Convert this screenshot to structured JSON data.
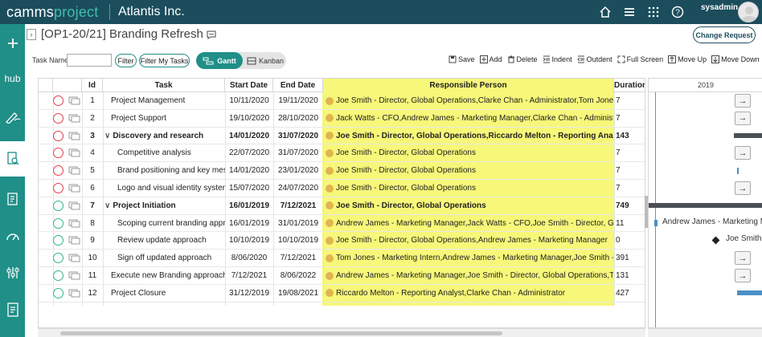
{
  "topbar": {
    "logo_a": "camms",
    "logo_b": "project",
    "org": "Atlantis Inc.",
    "user": "sysadmin",
    "icons": [
      "home-icon",
      "menu-icon",
      "apps-grid-icon",
      "help-icon"
    ]
  },
  "leftnav": {
    "items": [
      "add-icon",
      "hub",
      "pen-icon",
      "document-search-icon",
      "checklist-icon",
      "gauge-icon",
      "sliders-icon",
      "report-icon"
    ],
    "hub_label": "hub"
  },
  "title": {
    "project": "[OP1-20/21] Branding Refresh",
    "change_request": "Change Request"
  },
  "toolbar": {
    "task_name_label": "Task Name",
    "task_name_value": "",
    "filter": "Filter",
    "filter_my_tasks": "Filter My Tasks",
    "gantt": "Gantt",
    "kanban": "Kanban",
    "actions": [
      "Save",
      "Add",
      "Delete",
      "Indent",
      "Outdent",
      "Full Screen",
      "Move Up",
      "Move Down"
    ]
  },
  "grid": {
    "headers": {
      "id": "Id",
      "task": "Task",
      "start": "Start Date",
      "end": "End Date",
      "resp": "Responsible Person",
      "dur": "Duration"
    },
    "rows": [
      {
        "id": "1",
        "task": "Project Management",
        "start": "10/11/2020",
        "end": "19/11/2020",
        "resp": "Joe Smith - Director, Global Operations,Clarke Chan - Administrator,Tom Jones - Marketing Intern",
        "dur": "7",
        "status": "red",
        "bold": false,
        "indent": 0
      },
      {
        "id": "2",
        "task": "Project Support",
        "start": "19/10/2020",
        "end": "28/10/2020",
        "resp": "Jack Watts - CFO,Andrew James - Marketing Manager,Clarke Chan - Administrator",
        "dur": "7",
        "status": "red",
        "bold": false,
        "indent": 0
      },
      {
        "id": "3",
        "task": "Discovery and research",
        "start": "14/01/2020",
        "end": "31/07/2020",
        "resp": "Joe Smith - Director, Global Operations,Riccardo Melton - Reporting Analyst",
        "dur": "143",
        "status": "red",
        "bold": true,
        "indent": 0,
        "caret": "∨"
      },
      {
        "id": "4",
        "task": "Competitive analysis",
        "start": "22/07/2020",
        "end": "31/07/2020",
        "resp": "Joe Smith - Director, Global Operations",
        "dur": "7",
        "status": "red",
        "bold": false,
        "indent": 1
      },
      {
        "id": "5",
        "task": "Brand positioning and key messages",
        "start": "14/01/2020",
        "end": "23/01/2020",
        "resp": "Joe Smith - Director, Global Operations",
        "dur": "7",
        "status": "red",
        "bold": false,
        "indent": 1
      },
      {
        "id": "6",
        "task": "Logo and visual identity system update",
        "start": "15/07/2020",
        "end": "24/07/2020",
        "resp": "Joe Smith - Director, Global Operations",
        "dur": "7",
        "status": "red",
        "bold": false,
        "indent": 1
      },
      {
        "id": "7",
        "task": "Project Initiation",
        "start": "16/01/2019",
        "end": "7/12/2021",
        "resp": "Joe Smith - Director, Global Operations",
        "dur": "749",
        "status": "green",
        "bold": true,
        "indent": 0,
        "caret": "∨"
      },
      {
        "id": "8",
        "task": "Scoping current branding approach",
        "start": "16/01/2019",
        "end": "31/01/2019",
        "resp": "Andrew James - Marketing Manager,Jack Watts - CFO,Joe Smith - Director, Global Operations",
        "dur": "11",
        "status": "green",
        "bold": false,
        "indent": 1
      },
      {
        "id": "9",
        "task": "Review update approach",
        "start": "10/10/2019",
        "end": "10/10/2019",
        "resp": "Joe Smith - Director, Global Operations,Andrew James - Marketing Manager",
        "dur": "0",
        "status": "green",
        "bold": false,
        "indent": 1
      },
      {
        "id": "10",
        "task": "Sign off updated approach",
        "start": "8/06/2020",
        "end": "7/12/2021",
        "resp": "Tom Jones - Marketing Intern,Andrew James - Marketing Manager,Joe Smith - Director, Global Operations",
        "dur": "391",
        "status": "green",
        "bold": false,
        "indent": 1
      },
      {
        "id": "11",
        "task": "Execute new Branding approach",
        "start": "7/12/2021",
        "end": "8/06/2022",
        "resp": "Andrew James - Marketing Manager,Joe Smith - Director, Global Operations,Tom Jones - Marketing Intern",
        "dur": "131",
        "status": "green",
        "bold": false,
        "indent": 0
      },
      {
        "id": "12",
        "task": "Project Closure",
        "start": "31/12/2019",
        "end": "19/08/2021",
        "resp": "Riccardo Melton - Reporting Analyst,Clarke Chan - Administrator",
        "dur": "427",
        "status": "green",
        "bold": false,
        "indent": 0
      }
    ]
  },
  "gantt": {
    "year": "2019",
    "label_row8": "Andrew James - Marketing Manager",
    "label_row9": "Joe Smith",
    "arrow_glyph": "→",
    "colors": {
      "red": "#e0404a",
      "green": "#2fb38a",
      "bar": "#4a4f55",
      "highlight": "#f7f77a"
    }
  }
}
